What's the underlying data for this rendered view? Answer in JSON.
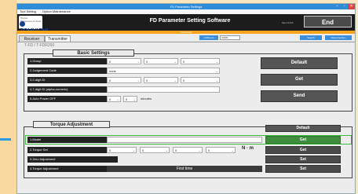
{
  "window": {
    "title": "FD Parameter Settings"
  },
  "menu": {
    "items": [
      "Tool Setting",
      "Option Maintenance"
    ]
  },
  "header": {
    "logo_top": "Torque Measurement Tools",
    "logo_brand": "TOHNICHI",
    "app_title": "FD Parameter Setting Software",
    "version": "Ver.1.0.0.0",
    "end_label": "End"
  },
  "status_bar": {
    "text": "Connected"
  },
  "tabs": [
    {
      "label": "Receiver"
    },
    {
      "label": "Transmitter"
    }
  ],
  "port": {
    "button": "COM port",
    "value": "COM1",
    "search": "Search",
    "disconnect": "Disconnection"
  },
  "model": "T-FD / T-FDR200",
  "basic": {
    "title": "Basic Settings",
    "rows": [
      {
        "label": "1.Group",
        "values": [
          "0",
          "0",
          "0"
        ]
      },
      {
        "label": "2.Judgement Code",
        "values": [
          "none"
        ]
      },
      {
        "label": "3.2-digit ID",
        "values": [
          "0",
          "0",
          "0"
        ]
      },
      {
        "label": "4.7-digit ID (alpha-numeric)",
        "values": [
          ""
        ]
      },
      {
        "label": "5.Auto Power OFF",
        "values": [
          "0",
          "0"
        ],
        "unit": "minutes"
      }
    ],
    "buttons": {
      "default": "Default",
      "get": "Get",
      "send": "Send"
    }
  },
  "torque": {
    "title": "Torque Adjustment",
    "rows": [
      {
        "label": "1.Model"
      },
      {
        "label": "2.Torque Set",
        "values": [
          "0",
          "0",
          "0",
          "0"
        ],
        "unit": "N · m"
      },
      {
        "label": "3.Zero Adjustment"
      },
      {
        "label": "4.Torque Adjustment",
        "status": "First time"
      }
    ],
    "buttons": {
      "default": "Default",
      "get": "Get",
      "set": "Set"
    }
  },
  "colors": {
    "accent": "#2f8cd8",
    "highlight": "#3fbd3f",
    "orange": "#f5a41c"
  }
}
